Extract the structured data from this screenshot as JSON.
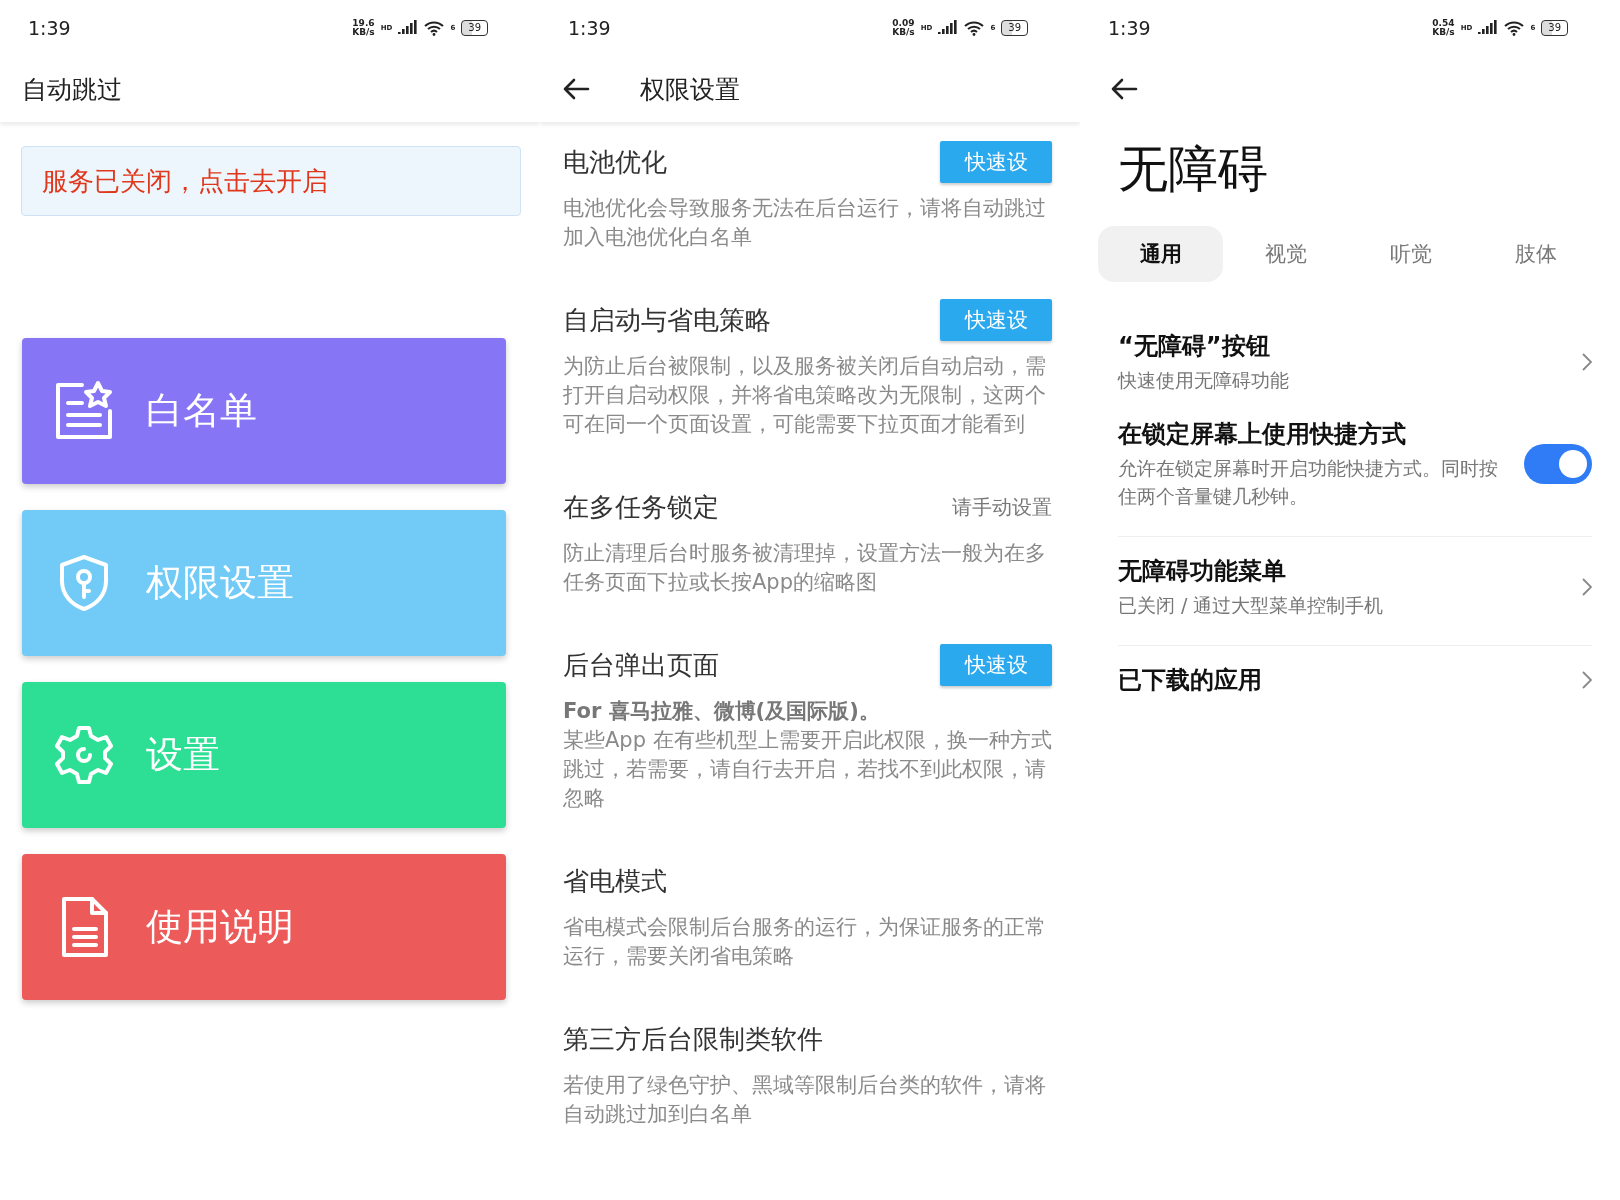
{
  "home": {
    "status": {
      "time": "1:39",
      "speed": "19.6",
      "speed_unit": "KB/s",
      "network": "HD",
      "wifi_label": "6",
      "battery": "39"
    },
    "title": "自动跳过",
    "notice": "服务已关闭，点击去开启",
    "cards": [
      {
        "kind": "list",
        "label": "白名单",
        "color": "#8676f5"
      },
      {
        "kind": "shield",
        "label": "权限设置",
        "color": "#72cbf7"
      },
      {
        "kind": "gear",
        "label": "设置",
        "color": "#2ddf95"
      },
      {
        "kind": "doc",
        "label": "使用说明",
        "color": "#ec5a5a"
      }
    ]
  },
  "permissions": {
    "status": {
      "time": "1:39",
      "speed": "0.09",
      "speed_unit": "KB/s",
      "network": "HD",
      "wifi_label": "6",
      "battery": "39"
    },
    "title": "权限设置",
    "sections": [
      {
        "kind": "quick",
        "title": "电池优化",
        "action": "快速设",
        "description": "电池优化会导致服务无法在后台运行，请将自动跳过加入电池优化白名单"
      },
      {
        "kind": "quick",
        "title": "自启动与省电策略",
        "action": "快速设",
        "description": "为防止后台被限制，以及服务被关闭后自动启动，需打开自启动权限，并将省电策略改为无限制，这两个可在同一个页面设置，可能需要下拉页面才能看到"
      },
      {
        "kind": "manual",
        "title": "在多任务锁定",
        "action": "请手动设置",
        "description": "防止清理后台时服务被清理掉，设置方法一般为在多任务页面下拉或长按App的缩略图"
      },
      {
        "kind": "quick",
        "title": "后台弹出页面",
        "action": "快速设",
        "note": "For 喜马拉雅、微博(及国际版)。",
        "description": "某些App 在有些机型上需要开启此权限，换一种方式跳过，若需要，请自行去开启，若找不到此权限，请忽略"
      },
      {
        "kind": "plain",
        "title": "省电模式",
        "description": "省电模式会限制后台服务的运行，为保证服务的正常运行，需要关闭省电策略"
      },
      {
        "kind": "plain",
        "title": "第三方后台限制类软件",
        "description": "若使用了绿色守护、黑域等限制后台类的软件，请将自动跳过加到白名单"
      }
    ]
  },
  "accessibility": {
    "status": {
      "time": "1:39",
      "speed": "0.54",
      "speed_unit": "KB/s",
      "network": "HD",
      "wifi_label": "6",
      "battery": "39"
    },
    "title": "无障碍",
    "tabs": [
      {
        "label": "通用",
        "selected": true
      },
      {
        "label": "视觉",
        "selected": false
      },
      {
        "label": "听觉",
        "selected": false
      },
      {
        "label": "肢体",
        "selected": false
      }
    ],
    "groups": [
      [
        {
          "kind": "link",
          "title": "“无障碍”按钮",
          "subtitle": "快速使用无障碍功能"
        },
        {
          "kind": "toggle",
          "title": "在锁定屏幕上使用快捷方式",
          "subtitle": "允许在锁定屏幕时开启功能快捷方式。同时按住两个音量键几秒钟。",
          "on": true
        }
      ],
      [
        {
          "kind": "link",
          "title": "无障碍功能菜单",
          "subtitle": "已关闭 / 通过大型菜单控制手机"
        }
      ],
      [
        {
          "kind": "link",
          "title": "已下载的应用"
        }
      ]
    ]
  }
}
